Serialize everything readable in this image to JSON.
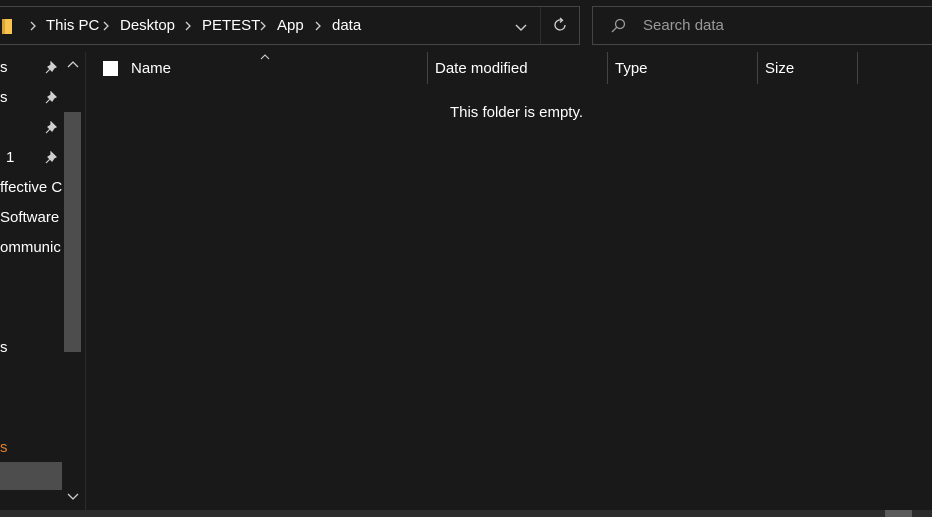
{
  "address_bar": {
    "breadcrumbs": [
      "This PC",
      "Desktop",
      "PETEST",
      "App",
      "data"
    ],
    "folder_icon": "folder-icon",
    "dropdown_icon": "chevron-down-icon",
    "refresh_icon": "refresh-icon"
  },
  "search": {
    "placeholder": "Search data",
    "icon": "search-icon"
  },
  "nav_pane": {
    "items": [
      {
        "label": "s",
        "pinned": true
      },
      {
        "label": "s",
        "pinned": true
      },
      {
        "label": "",
        "pinned": true
      },
      {
        "label": "1",
        "pinned": true
      },
      {
        "label": "ffective C",
        "pinned": false
      },
      {
        "label": "Software",
        "pinned": false
      },
      {
        "label": "ommunic",
        "pinned": false
      },
      {
        "label": "s",
        "pinned": false
      },
      {
        "label": "s",
        "pinned": false
      }
    ]
  },
  "columns": {
    "name": "Name",
    "date_modified": "Date modified",
    "type": "Type",
    "size": "Size"
  },
  "empty_message": "This folder is empty.",
  "colors": {
    "background": "#191919",
    "text": "#ffffff",
    "placeholder": "#9a9a9a",
    "border": "#454545",
    "folder": "#f8c44f",
    "accent_orange": "#e1802c",
    "scroll_thumb": "#4d4d4d"
  }
}
